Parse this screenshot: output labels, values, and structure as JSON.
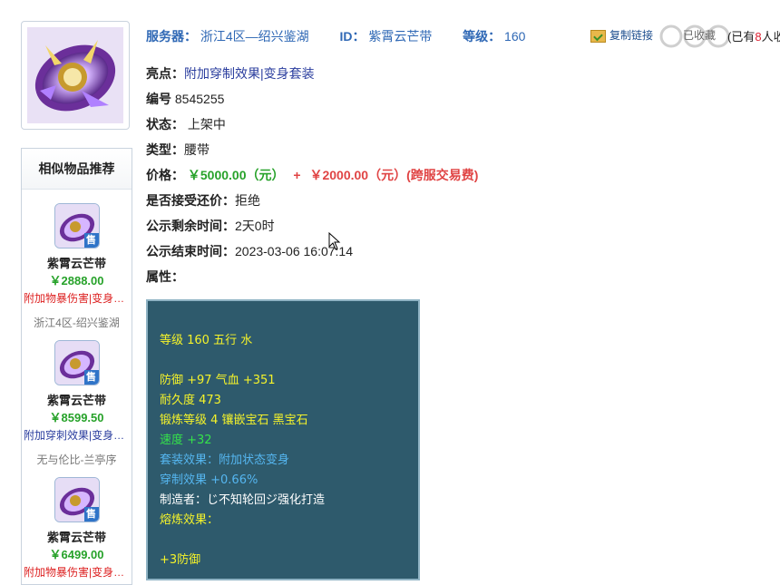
{
  "header": {
    "server_label": "服务器",
    "server_value": "浙江4区—绍兴鉴湖",
    "id_label": "ID",
    "id_value": "紫霄云芒带",
    "level_label": "等级",
    "level_value": "160",
    "copy_link": "复制链接",
    "favorite": "已收藏",
    "watch_prefix": "(已有",
    "watch_count": "8",
    "watch_suffix": "人收"
  },
  "details": {
    "highlight_label": "亮点：",
    "highlight_value": "附加穿制效果|变身套装",
    "number_label": "编号",
    "number_value": "8545255",
    "status_label": "状态：",
    "status_value": "上架中",
    "type_label": "类型：",
    "type_value": "腰带",
    "price_label": "价格：",
    "price_main": "￥5000.00（元）",
    "price_plus": "+",
    "price_cross": "￥2000.00（元）(跨服交易费)",
    "counter_label": "是否接受还价：",
    "counter_value": "拒绝",
    "remaining_label": "公示剩余时间：",
    "remaining_value": "2天0时",
    "end_label": "公示结束时间：",
    "end_value": "2023-03-06 16:07:14",
    "attr_label": "属性："
  },
  "attributes": {
    "line1": "等级 160 五行 水",
    "line2": "防御 +97 气血 +351",
    "line3": "耐久度 473",
    "line4": "锻炼等级 4 镶嵌宝石 黑宝石",
    "line5": "速度 +32",
    "line6": "套装效果：附加状态变身",
    "line7": "穿制效果 +0.66%",
    "line8": "制造者：じ不知轮回ジ强化打造",
    "line9": "熔炼效果：",
    "line10": "+3防御"
  },
  "recommend": {
    "title": "相似物品推荐",
    "sell_tag": "售",
    "items": [
      {
        "name": "紫霄云芒带",
        "price": "￥2888.00",
        "desc": "附加物暴伤害|变身套装",
        "server": "浙江4区-绍兴鉴湖"
      },
      {
        "name": "紫霄云芒带",
        "price": "￥8599.50",
        "desc": "附加穿刺效果|变身套装",
        "server": "无与伦比-兰亭序"
      },
      {
        "name": "紫霄云芒带",
        "price": "￥6499.00",
        "desc": "附加物暴伤害|变身套装",
        "server": ""
      }
    ]
  },
  "colors": {
    "accent_blue": "#2f68b5",
    "price_green": "#27a22a",
    "price_red": "#e04444",
    "attr_bg": "#2e5a6c"
  }
}
